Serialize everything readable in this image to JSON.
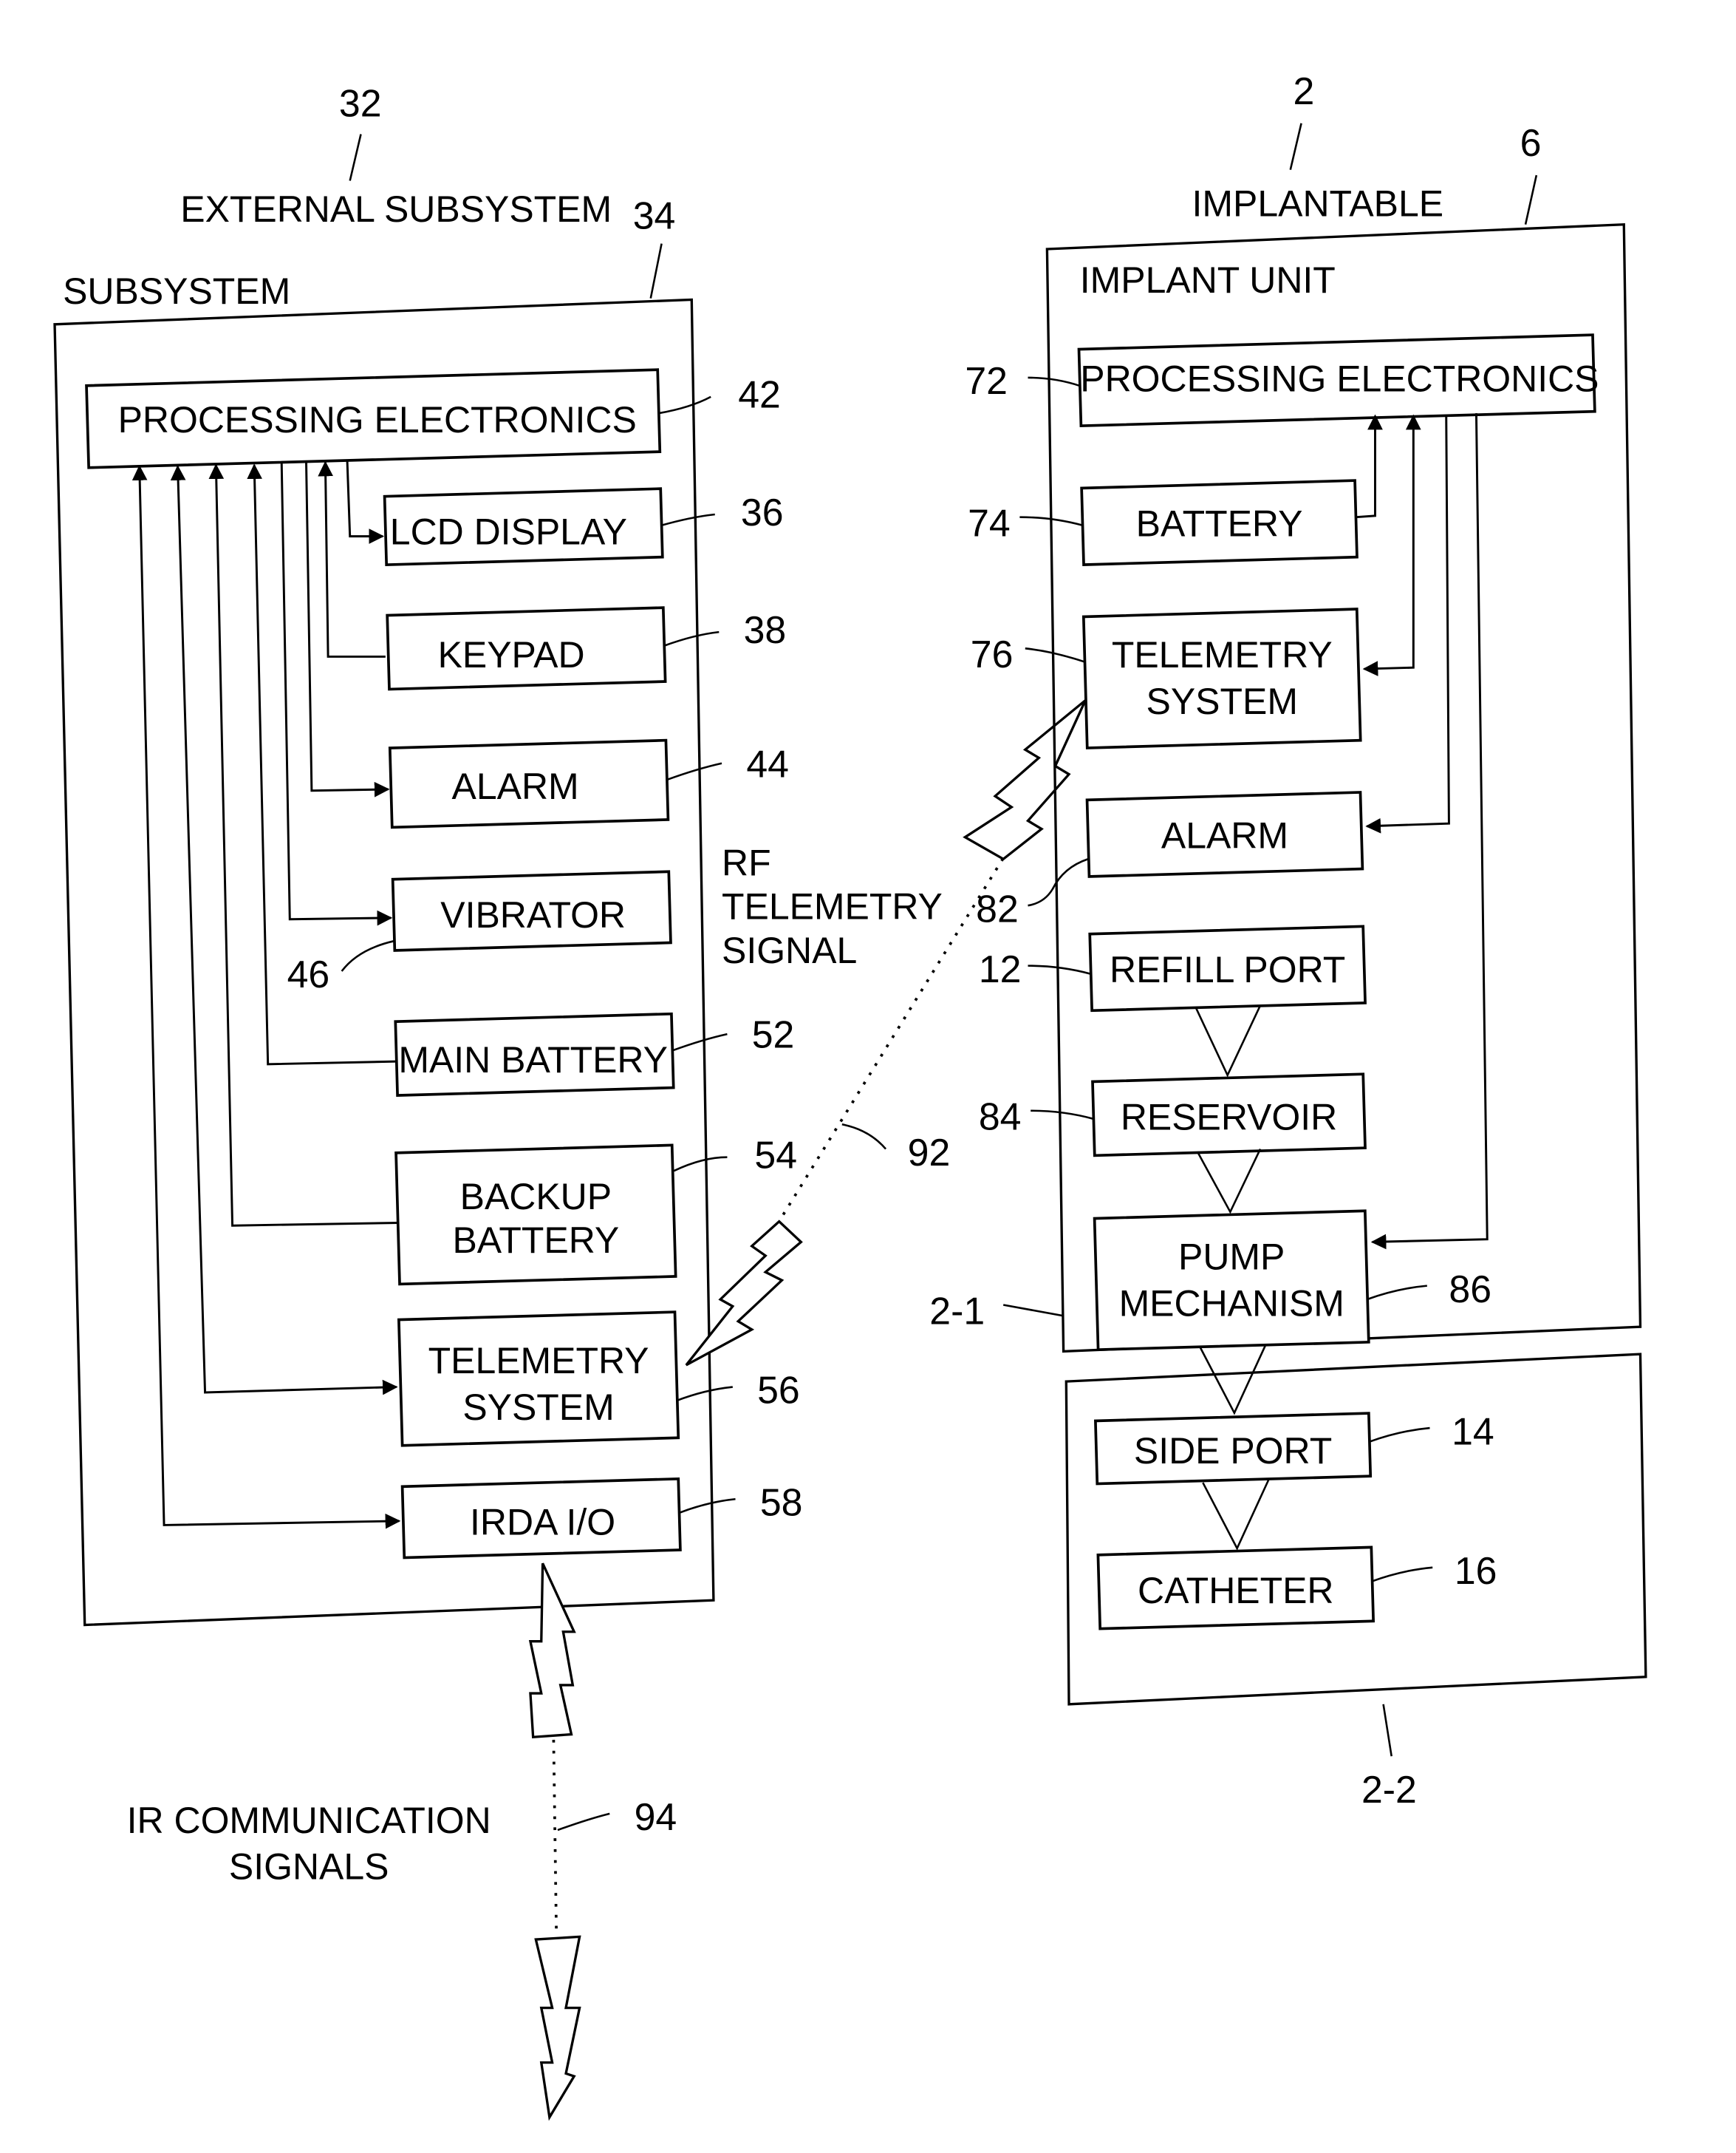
{
  "figure": {
    "external": {
      "title": "EXTERNAL SUBSYSTEM",
      "title_ref": "32",
      "subsystem_label": "SUBSYSTEM",
      "subsystem_ref": "34",
      "blocks": [
        {
          "id": "proc",
          "label": "PROCESSING ELECTRONICS",
          "ref": "42"
        },
        {
          "id": "lcd",
          "label": "LCD DISPLAY",
          "ref": "36"
        },
        {
          "id": "keypad",
          "label": "KEYPAD",
          "ref": "38"
        },
        {
          "id": "alarm",
          "label": "ALARM",
          "ref": "44"
        },
        {
          "id": "vibrator",
          "label": "VIBRATOR",
          "ref": "46"
        },
        {
          "id": "main_battery",
          "label": "MAIN BATTERY",
          "ref": "52"
        },
        {
          "id": "backup_battery",
          "label_line1": "BACKUP",
          "label_line2": "BATTERY",
          "ref": "54"
        },
        {
          "id": "telemetry",
          "label_line1": "TELEMETRY",
          "label_line2": "SYSTEM",
          "ref": "56"
        },
        {
          "id": "irda",
          "label": "IRDA I/O",
          "ref": "58"
        }
      ]
    },
    "rf_signal": {
      "line1": "RF",
      "line2": "TELEMETRY",
      "line3": "SIGNAL",
      "ref": "92"
    },
    "ir_signal": {
      "line1": "IR COMMUNICATION",
      "line2": "SIGNALS",
      "ref": "94"
    },
    "implantable": {
      "title": "IMPLANTABLE",
      "title_ref": "2",
      "unit_label": "IMPLANT UNIT",
      "unit_ref": "6",
      "section1_ref": "2-1",
      "section2_ref": "2-2",
      "blocks": [
        {
          "id": "proc",
          "label": "PROCESSING ELECTRONICS",
          "ref": "72"
        },
        {
          "id": "battery",
          "label": "BATTERY",
          "ref": "74"
        },
        {
          "id": "telemetry",
          "label_line1": "TELEMETRY",
          "label_line2": "SYSTEM",
          "ref": "76"
        },
        {
          "id": "alarm",
          "label": "ALARM",
          "ref": "82"
        },
        {
          "id": "refill_port",
          "label": "REFILL PORT",
          "ref": "12"
        },
        {
          "id": "reservoir",
          "label": "RESERVOIR",
          "ref": "84"
        },
        {
          "id": "pump",
          "label_line1": "PUMP",
          "label_line2": "MECHANISM",
          "ref": "86"
        },
        {
          "id": "side_port",
          "label": "SIDE PORT",
          "ref": "14"
        },
        {
          "id": "catheter",
          "label": "CATHETER",
          "ref": "16"
        }
      ]
    }
  }
}
